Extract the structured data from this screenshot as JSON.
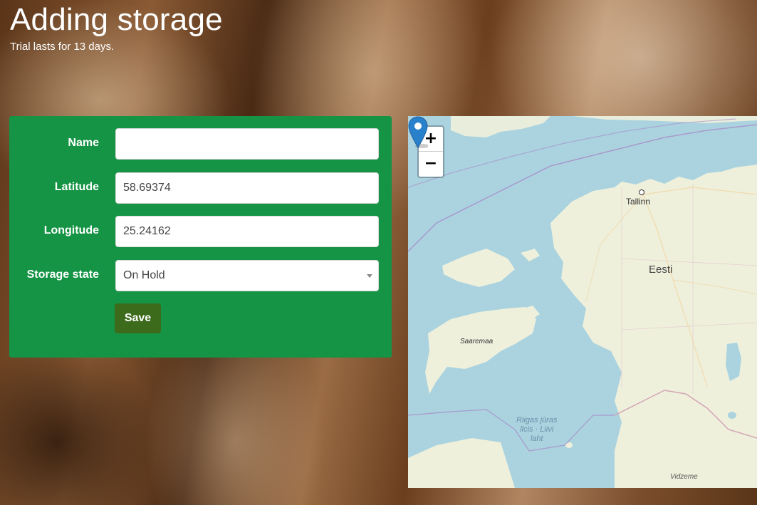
{
  "header": {
    "title": "Adding storage",
    "subtitle": "Trial lasts for 13 days."
  },
  "form": {
    "name": {
      "label": "Name",
      "value": ""
    },
    "latitude": {
      "label": "Latitude",
      "value": "58.69374"
    },
    "longitude": {
      "label": "Longitude",
      "value": "25.24162"
    },
    "storage_state": {
      "label": "Storage state",
      "selected": "On Hold"
    },
    "save_label": "Save"
  },
  "map": {
    "zoom_in": "+",
    "zoom_out": "−",
    "labels": {
      "city": "Tallinn",
      "country": "Eesti",
      "island": "Saaremaa",
      "sea_line1": "Riigas jūras",
      "sea_line2": "līcis · Liivi",
      "sea_line3": "laht",
      "region": "Vidzeme"
    },
    "colors": {
      "water": "#aad3df",
      "land": "#eef0dc",
      "marker": "#2a81cb"
    }
  },
  "colors": {
    "form_panel": "#149444",
    "save_button": "#3c6b1c"
  }
}
